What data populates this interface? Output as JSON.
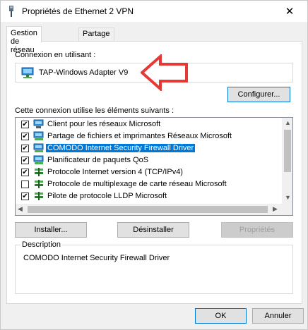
{
  "window": {
    "title": "Propriétés de Ethernet 2 VPN",
    "close_glyph": "✕"
  },
  "tabs": [
    {
      "label": "Gestion de réseau"
    },
    {
      "label": "Partage"
    }
  ],
  "connection": {
    "label": "Connexion en utilisant :",
    "adapter": "TAP-Windows Adapter V9",
    "configure_label": "Configurer..."
  },
  "components": {
    "label": "Cette connexion utilise les éléments suivants :",
    "items": [
      {
        "label": "Client pour les réseaux Microsoft",
        "checked": "✔",
        "icon": "network-client-icon"
      },
      {
        "label": "Partage de fichiers et imprimantes Réseaux Microsoft",
        "checked": "✔",
        "icon": "network-service-icon"
      },
      {
        "label": "COMODO Internet Security Firewall Driver",
        "checked": "✔",
        "icon": "network-service-icon"
      },
      {
        "label": "Planificateur de paquets QoS",
        "checked": "✔",
        "icon": "network-service-icon"
      },
      {
        "label": "Protocole Internet version 4 (TCP/IPv4)",
        "checked": "✔",
        "icon": "protocol-icon"
      },
      {
        "label": "Protocole de multiplexage de carte réseau Microsoft",
        "checked": "",
        "icon": "protocol-icon"
      },
      {
        "label": "Pilote de protocole LLDP Microsoft",
        "checked": "✔",
        "icon": "protocol-icon"
      }
    ]
  },
  "buttons": {
    "install": "Installer...",
    "uninstall": "Désinstaller",
    "properties": "Propriétés",
    "ok": "OK",
    "cancel": "Annuler"
  },
  "description": {
    "legend": "Description",
    "text": "COMODO Internet Security Firewall Driver"
  },
  "colors": {
    "selection": "#0078d7",
    "arrow": "#e53935"
  }
}
